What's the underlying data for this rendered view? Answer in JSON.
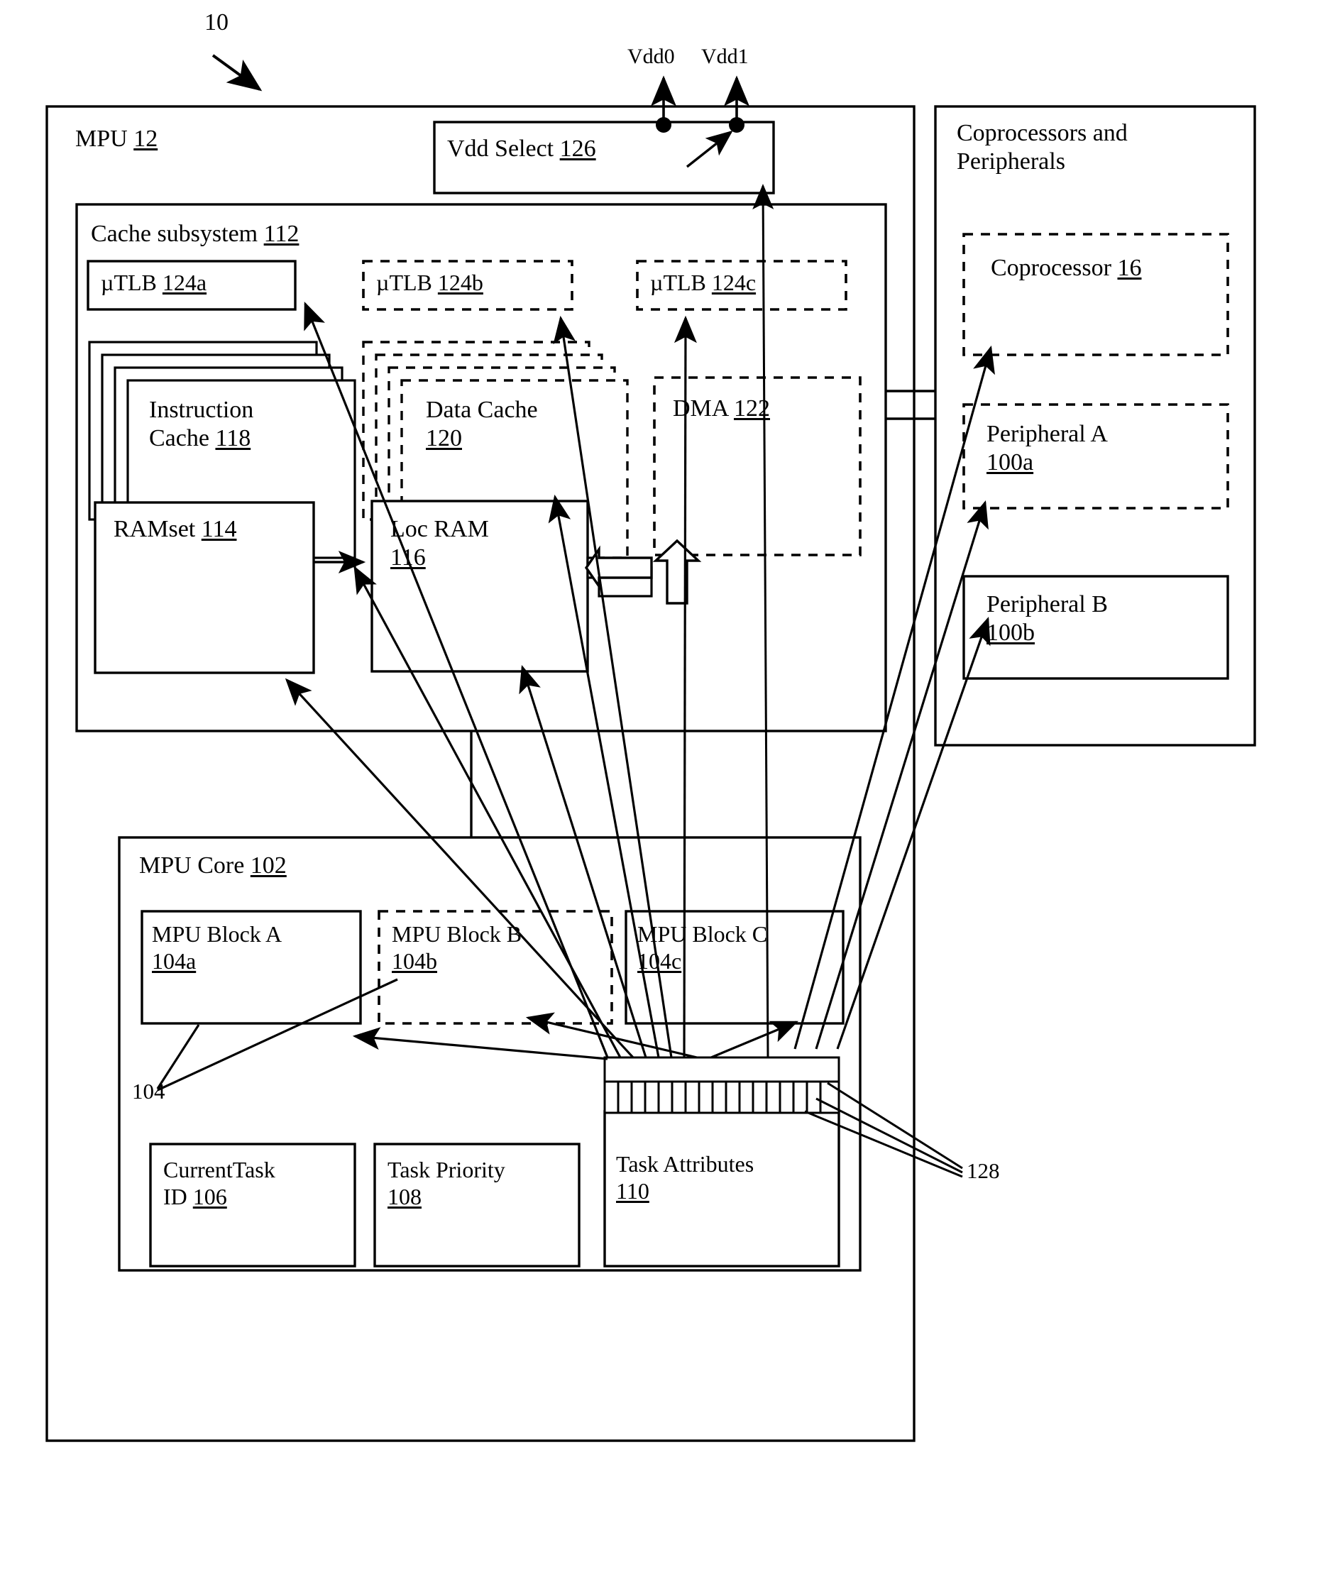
{
  "figure": {
    "ref_numeral": "10",
    "callout_104": "104",
    "callout_128": "128"
  },
  "power": {
    "vdd0": "Vdd0",
    "vdd1": "Vdd1",
    "vdd_select": "Vdd Select",
    "vdd_select_num": "126"
  },
  "mpu": {
    "title": "MPU",
    "num": "12"
  },
  "cache": {
    "title": "Cache subsystem",
    "num": "112",
    "utlb_a": {
      "label": "µTLB",
      "num": "124a",
      "style": "solid"
    },
    "utlb_b": {
      "label": "µTLB",
      "num": "124b",
      "style": "dashed"
    },
    "utlb_c": {
      "label": "µTLB",
      "num": "124c",
      "style": "dashed"
    },
    "instruction_cache": {
      "line1": "Instruction",
      "line2": "Cache",
      "num": "118",
      "style": "solid",
      "stack": 3
    },
    "data_cache": {
      "line1": "Data Cache",
      "num": "120",
      "style": "dashed",
      "stack": 3
    },
    "ramset": {
      "label": "RAMset",
      "num": "114",
      "style": "solid"
    },
    "loc_ram": {
      "line1": "Loc RAM",
      "num": "116",
      "style": "solid"
    },
    "dma": {
      "label": "DMA",
      "num": "122",
      "style": "dashed"
    }
  },
  "core": {
    "title": "MPU Core",
    "num": "102",
    "blocks": [
      {
        "label": "MPU Block A",
        "num": "104a",
        "style": "solid"
      },
      {
        "label": "MPU Block B",
        "num": "104b",
        "style": "dashed"
      },
      {
        "label": "MPU Block C",
        "num": "104c",
        "style": "solid"
      }
    ],
    "current_task": {
      "line1": "CurrentTask",
      "line2": "ID",
      "num": "106"
    },
    "task_priority": {
      "line1": "Task Priority",
      "num": "108"
    },
    "task_attributes": {
      "line1": "Task Attributes",
      "num": "110",
      "cells": 17
    }
  },
  "external": {
    "title_line1": "Coprocessors and",
    "title_line2": "Peripherals",
    "coprocessor": {
      "label": "Coprocessor",
      "num": "16",
      "style": "dashed"
    },
    "peripheral_a": {
      "line1": "Peripheral A",
      "num": "100a",
      "style": "dashed"
    },
    "peripheral_b": {
      "line1": "Peripheral B",
      "num": "100b",
      "style": "solid"
    }
  },
  "colors": {
    "ink": "#000000",
    "paper": "#ffffff"
  }
}
